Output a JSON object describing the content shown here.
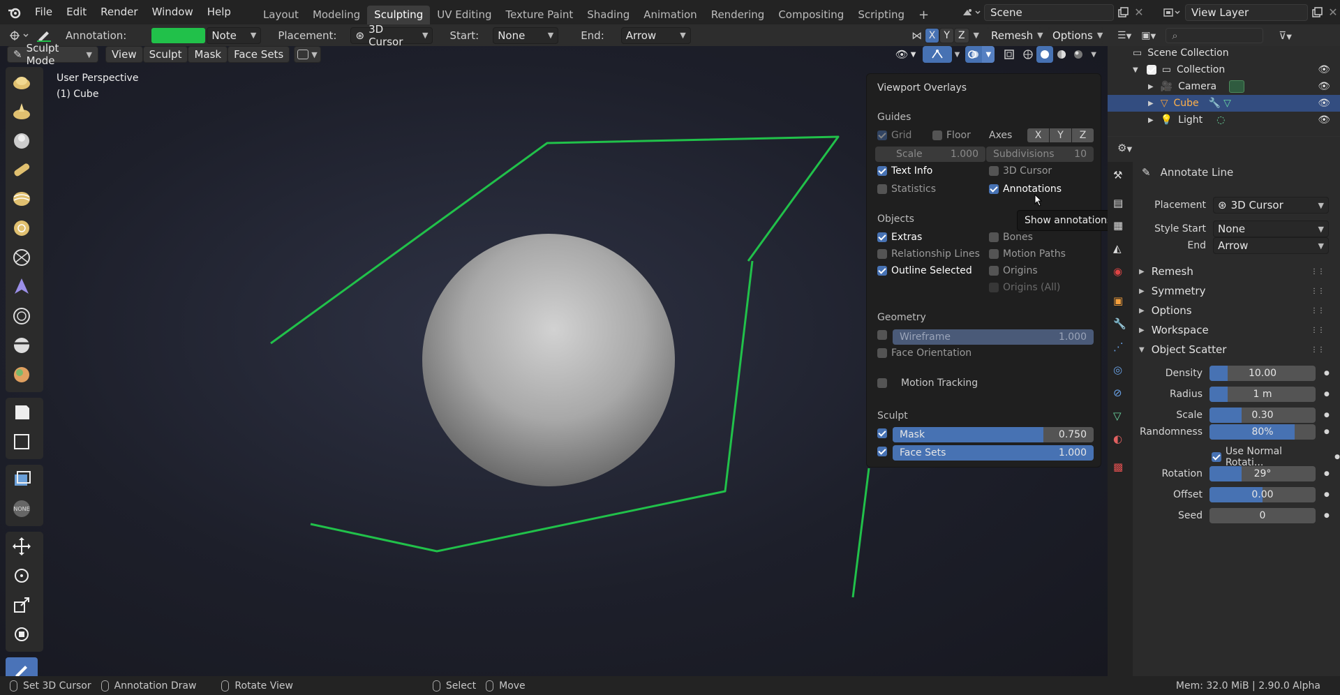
{
  "topbar": {
    "menus": [
      "File",
      "Edit",
      "Render",
      "Window",
      "Help"
    ],
    "workspaces": [
      "Layout",
      "Modeling",
      "Sculpting",
      "UV Editing",
      "Texture Paint",
      "Shading",
      "Animation",
      "Rendering",
      "Compositing",
      "Scripting"
    ],
    "active_workspace": "Sculpting",
    "add_tab": "+",
    "scene": "Scene",
    "view_layer": "View Layer"
  },
  "header": {
    "annotation_label": "Annotation:",
    "annotation_color": "#21c14a",
    "note": "Note",
    "placement_label": "Placement:",
    "placement": "3D Cursor",
    "start_label": "Start:",
    "start": "None",
    "end_label": "End:",
    "end": "Arrow",
    "axes": [
      "X",
      "Y",
      "Z"
    ],
    "remesh": "Remesh",
    "options": "Options"
  },
  "viewport_header": {
    "mode": "Sculpt Mode",
    "menus": [
      "View",
      "Sculpt",
      "Mask",
      "Face Sets"
    ]
  },
  "viewport": {
    "perspective": "User Perspective",
    "object": "(1) Cube"
  },
  "overlays": {
    "title": "Viewport Overlays",
    "guides": {
      "heading": "Guides",
      "grid": "Grid",
      "floor": "Floor",
      "axes_label": "Axes",
      "axes": [
        "X",
        "Y",
        "Z"
      ],
      "scale_label": "Scale",
      "scale": "1.000",
      "subdivisions_label": "Subdivisions",
      "subdivisions": "10",
      "text_info": "Text Info",
      "cursor": "3D Cursor",
      "statistics": "Statistics",
      "annotations": "Annotations"
    },
    "objects": {
      "heading": "Objects",
      "extras": "Extras",
      "bones": "Bones",
      "relationship_lines": "Relationship Lines",
      "motion_paths": "Motion Paths",
      "outline_selected": "Outline Selected",
      "origins": "Origins",
      "origins_all": "Origins (All)"
    },
    "geometry": {
      "heading": "Geometry",
      "wireframe": "Wireframe",
      "wireframe_value": "1.000",
      "face_orientation": "Face Orientation",
      "motion_tracking": "Motion Tracking"
    },
    "sculpt": {
      "heading": "Sculpt",
      "mask": "Mask",
      "mask_value": "0.750",
      "mask_fraction": 0.75,
      "face_sets": "Face Sets",
      "face_sets_value": "1.000"
    }
  },
  "tooltip": "Show annotations for this view.",
  "outliner": {
    "root": "Scene Collection",
    "collection": "Collection",
    "items": [
      "Camera",
      "Cube",
      "Light"
    ]
  },
  "properties": {
    "tool_name": "Annotate Line",
    "placement_label": "Placement",
    "placement": "3D Cursor",
    "style_start_label": "Style Start",
    "style_start": "None",
    "end_label": "End",
    "end": "Arrow",
    "panels": [
      "Remesh",
      "Symmetry",
      "Options",
      "Workspace",
      "Object Scatter"
    ],
    "scatter": {
      "density_label": "Density",
      "density": "10.00",
      "density_fraction": 0.17,
      "radius_label": "Radius",
      "radius": "1 m",
      "radius_fraction": 0.17,
      "scale_label": "Scale",
      "scale": "0.30",
      "scale_fraction": 0.3,
      "randomness_label": "Randomness",
      "randomness": "80%",
      "randomness_fraction": 0.8,
      "use_normal_rotation": "Use Normal Rotati...",
      "rotation_label": "Rotation",
      "rotation": "29°",
      "rotation_fraction": 0.3,
      "offset_label": "Offset",
      "offset": "0.00",
      "offset_fraction": 0.5,
      "seed_label": "Seed",
      "seed": "0"
    }
  },
  "status": {
    "items": [
      "Set 3D Cursor",
      "Annotation Draw",
      "Rotate View",
      "Select",
      "Move"
    ],
    "memory": "Mem: 32.0 MiB | 2.90.0 Alpha"
  }
}
